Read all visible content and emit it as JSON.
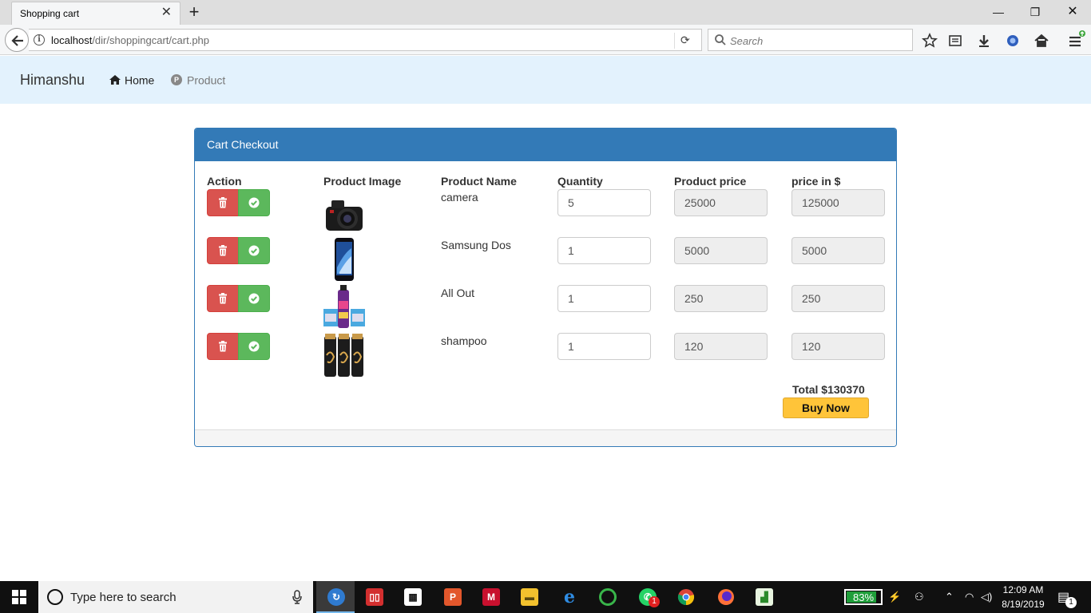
{
  "browser": {
    "tab_title": "Shopping cart",
    "url_host": "localhost",
    "url_path": "/dir/shoppingcart/cart.php",
    "search_placeholder": "Search"
  },
  "site": {
    "brand": "Himanshu",
    "nav": {
      "home": "Home",
      "product": "Product"
    }
  },
  "panel": {
    "heading": "Cart Checkout",
    "columns": [
      "Action",
      "Product Image",
      "Product Name",
      "Quantity",
      "Product price",
      "price in $"
    ],
    "rows": [
      {
        "name": "camera",
        "quantity": "5",
        "price": "25000",
        "line_total": "125000",
        "image": "camera-image"
      },
      {
        "name": "Samsung Dos",
        "quantity": "1",
        "price": "5000",
        "line_total": "5000",
        "image": "phone-image"
      },
      {
        "name": "All Out",
        "quantity": "1",
        "price": "250",
        "line_total": "250",
        "image": "spray-image"
      },
      {
        "name": "shampoo",
        "quantity": "1",
        "price": "120",
        "line_total": "120",
        "image": "shampoo-image"
      }
    ],
    "total": "Total $130370",
    "buy_label": "Buy Now"
  },
  "taskbar": {
    "search_text": "Type here to search",
    "battery": "83%",
    "time": "12:09 AM",
    "date": "8/19/2019",
    "whatsapp_badge": "1",
    "notification_badge": "1"
  },
  "colors": {
    "panel_primary": "#337ab7",
    "nav_bg": "#e3f2fd",
    "danger": "#d9534f",
    "success": "#5cb85c",
    "buy": "#ffc439"
  }
}
